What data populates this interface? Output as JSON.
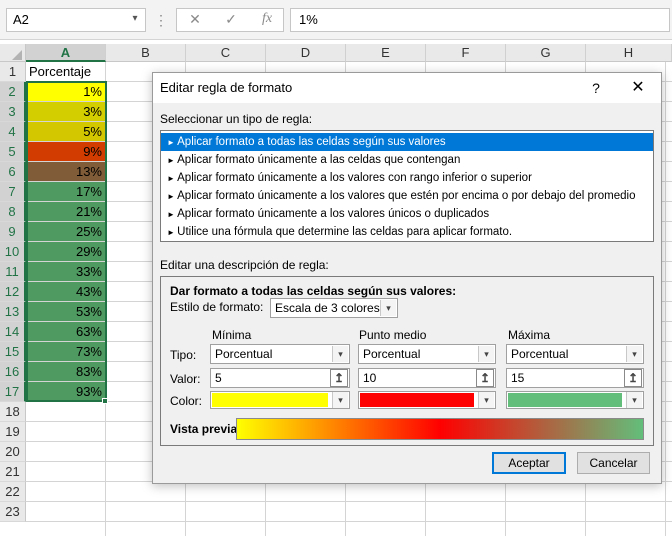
{
  "formula_bar": {
    "name_box": "A2",
    "value": "1%",
    "cancel_icon": "✕",
    "enter_icon": "✓",
    "fx_label": "fx"
  },
  "sheet": {
    "columns": [
      "A",
      "B",
      "C",
      "D",
      "E",
      "F",
      "G",
      "H"
    ],
    "rows": [
      "1",
      "2",
      "3",
      "4",
      "5",
      "6",
      "7",
      "8",
      "9",
      "10",
      "11",
      "12",
      "13",
      "14",
      "15",
      "16",
      "17",
      "18",
      "19",
      "20",
      "21",
      "22",
      "23"
    ],
    "header_cell": "Porcentaje",
    "values": [
      "1%",
      "3%",
      "5%",
      "9%",
      "13%",
      "17%",
      "21%",
      "25%",
      "29%",
      "33%",
      "43%",
      "53%",
      "63%",
      "73%",
      "83%",
      "93%"
    ],
    "fill_colors": [
      "#ffff00",
      "#d3ce00",
      "#d3c800",
      "#d33c00",
      "#805c38",
      "#4f9a60",
      "#4f9a60",
      "#4f9a60",
      "#4f9a60",
      "#4f9a60",
      "#4f9a60",
      "#4f9a60",
      "#4f9a60",
      "#4f9a60",
      "#4f9a60",
      "#4f9a60"
    ]
  },
  "dialog": {
    "title": "Editar regla de formato",
    "help": "?",
    "close": "✕",
    "select_type_label": "Seleccionar un tipo de regla:",
    "rule_types": [
      "Aplicar formato a todas las celdas según sus valores",
      "Aplicar formato únicamente a las celdas que contengan",
      "Aplicar formato únicamente a los valores con rango inferior o superior",
      "Aplicar formato únicamente a los valores que estén por encima o por debajo del promedio",
      "Aplicar formato únicamente a los valores únicos o duplicados",
      "Utilice una fórmula que determine las celdas para aplicar formato."
    ],
    "edit_desc_label": "Editar una descripción de regla:",
    "desc_heading": "Dar formato a todas las celdas según sus valores:",
    "format_style_label": "Estilo de formato:",
    "format_style_value": "Escala de 3 colores",
    "col_min": "Mínima",
    "col_mid": "Punto medio",
    "col_max": "Máxima",
    "tipo_label": "Tipo:",
    "valor_label": "Valor:",
    "color_label": "Color:",
    "min_type": "Porcentual",
    "mid_type": "Porcentual",
    "max_type": "Porcentual",
    "min_value": "5",
    "mid_value": "10",
    "max_value": "15",
    "min_color": "#ffff00",
    "mid_color": "#ff0000",
    "max_color": "#63be7b",
    "preview_label": "Vista previa:",
    "ok": "Aceptar",
    "cancel": "Cancelar"
  }
}
